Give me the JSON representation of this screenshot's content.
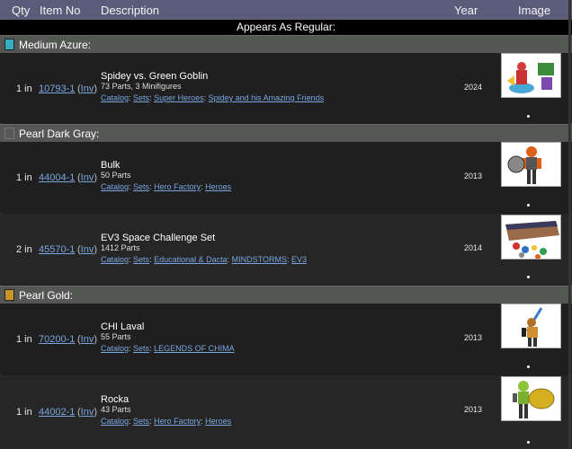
{
  "header": {
    "qty": "Qty",
    "item_no": "Item No",
    "description": "Description",
    "year": "Year",
    "image": "Image"
  },
  "banner": "Appears As Regular:",
  "groups": [
    {
      "color_name": "Medium Azure:",
      "swatch": "#36aebf",
      "rows": [
        {
          "qty": "1 in",
          "item_no": "10793-1",
          "inv": "Inv",
          "title": "Spidey vs. Green Goblin",
          "parts": "73 Parts, 3 Minifigures",
          "catalog": [
            "Catalog",
            "Sets",
            "Super Heroes",
            "Spidey and his Amazing Friends"
          ],
          "year": "2024",
          "image_icon": "set-image"
        }
      ]
    },
    {
      "color_name": "Pearl Dark Gray:",
      "swatch": "#575857",
      "rows": [
        {
          "qty": "1 in",
          "item_no": "44004-1",
          "inv": "Inv",
          "title": "Bulk",
          "parts": "50 Parts",
          "catalog": [
            "Catalog",
            "Sets",
            "Hero Factory",
            "Heroes"
          ],
          "year": "2013",
          "image_icon": "set-image"
        },
        {
          "qty": "2 in",
          "item_no": "45570-1",
          "inv": "Inv",
          "title": "EV3 Space Challenge Set",
          "parts": "1412 Parts",
          "catalog": [
            "Catalog",
            "Sets",
            "Educational & Dacta",
            "MINDSTORMS",
            "EV3"
          ],
          "year": "2014",
          "image_icon": "set-image"
        }
      ]
    },
    {
      "color_name": "Pearl Gold:",
      "swatch": "#c8962a",
      "rows": [
        {
          "qty": "1 in",
          "item_no": "70200-1",
          "inv": "Inv",
          "title": "CHI Laval",
          "parts": "55 Parts",
          "catalog": [
            "Catalog",
            "Sets",
            "LEGENDS OF CHIMA"
          ],
          "year": "2013",
          "image_icon": "set-image"
        },
        {
          "qty": "1 in",
          "item_no": "44002-1",
          "inv": "Inv",
          "title": "Rocka",
          "parts": "43 Parts",
          "catalog": [
            "Catalog",
            "Sets",
            "Hero Factory",
            "Heroes"
          ],
          "year": "2013",
          "image_icon": "set-image"
        }
      ]
    }
  ]
}
